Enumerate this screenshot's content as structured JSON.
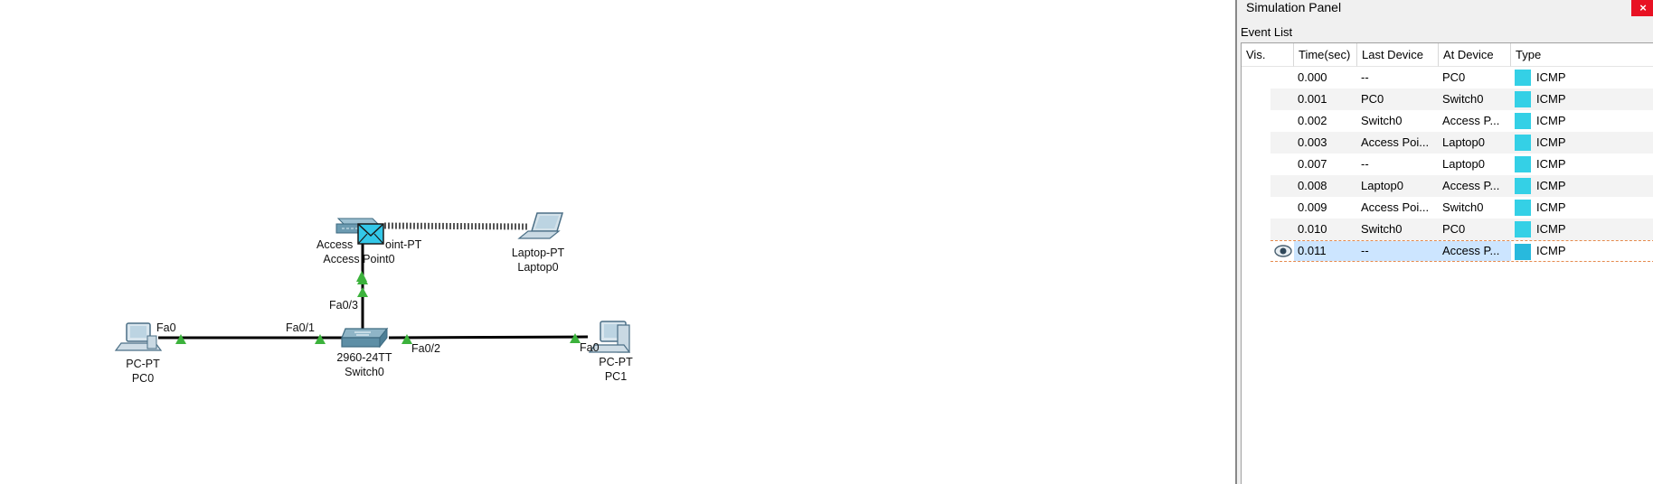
{
  "topology": {
    "devices": [
      {
        "key": "pc0",
        "model": "PC-PT",
        "name": "PC0"
      },
      {
        "key": "switch0",
        "model": "2960-24TT",
        "name": "Switch0"
      },
      {
        "key": "ap0",
        "model": "AccessPoint-PT",
        "model_visible": "Access",
        "model_visible_tail": "oint-PT",
        "name": "Access Point0"
      },
      {
        "key": "laptop0",
        "model": "Laptop-PT",
        "name": "Laptop0"
      },
      {
        "key": "pc1",
        "model": "PC-PT",
        "name": "PC1"
      }
    ],
    "ports": {
      "pc0_fa0": "Fa0",
      "switch_fa01": "Fa0/1",
      "switch_fa03": "Fa0/3",
      "switch_fa02": "Fa0/2",
      "pc1_fa0": "Fa0"
    },
    "link_color": "#000000",
    "link_up_color": "#3cb23c",
    "pdu_color": "#33c7e8"
  },
  "simulation_panel": {
    "title": "Simulation Panel",
    "close_label": "×",
    "event_list_label": "Event List",
    "columns": [
      "Vis.",
      "Time(sec)",
      "Last Device",
      "At Device",
      "Type"
    ],
    "events": [
      {
        "time": "0.000",
        "last": "--",
        "at": "PC0",
        "type": "ICMP"
      },
      {
        "time": "0.001",
        "last": "PC0",
        "at": "Switch0",
        "type": "ICMP"
      },
      {
        "time": "0.002",
        "last": "Switch0",
        "at": "Access P...",
        "type": "ICMP"
      },
      {
        "time": "0.003",
        "last": "Access Poi...",
        "at": "Laptop0",
        "type": "ICMP"
      },
      {
        "time": "0.007",
        "last": "--",
        "at": "Laptop0",
        "type": "ICMP"
      },
      {
        "time": "0.008",
        "last": "Laptop0",
        "at": "Access P...",
        "type": "ICMP"
      },
      {
        "time": "0.009",
        "last": "Access Poi...",
        "at": "Switch0",
        "type": "ICMP"
      },
      {
        "time": "0.010",
        "last": "Switch0",
        "at": "PC0",
        "type": "ICMP"
      },
      {
        "time": "0.011",
        "last": "--",
        "at": "Access P...",
        "type": "ICMP",
        "selected": true,
        "visible_icon": "eye-icon"
      }
    ],
    "icmp_color": "#34d0e6",
    "icmp_selected_color": "#28b9dd"
  }
}
